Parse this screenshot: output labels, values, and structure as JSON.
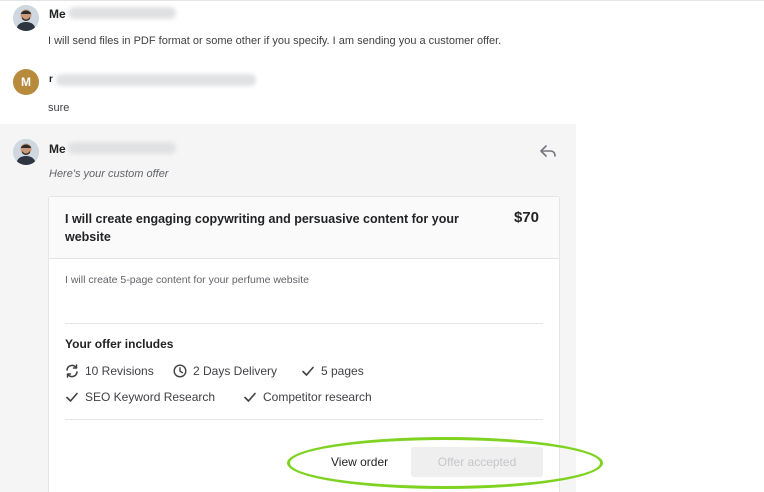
{
  "messages": [
    {
      "sender": "Me",
      "text": "I will send files in PDF format or some other if you specify. I am sending you a customer offer."
    },
    {
      "avatar_letter": "M",
      "sender": "r",
      "text": "sure"
    },
    {
      "sender": "Me",
      "subtitle": "Here's your custom offer",
      "reply_icon": "reply-icon"
    }
  ],
  "offer": {
    "title": "I will create engaging copywriting and persuasive content for your website",
    "price": "$70",
    "description": "I will create 5-page content for your perfume website",
    "includes_title": "Your offer includes",
    "features": [
      {
        "icon": "refresh-icon",
        "label": "10 Revisions"
      },
      {
        "icon": "clock-icon",
        "label": "2 Days Delivery"
      },
      {
        "icon": "check-icon",
        "label": "5 pages"
      },
      {
        "icon": "check-icon",
        "label": "SEO Keyword Research"
      },
      {
        "icon": "check-icon",
        "label": "Competitor research"
      }
    ],
    "view_order_label": "View order",
    "accepted_label": "Offer accepted"
  },
  "colors": {
    "highlight": "#7ed321",
    "avatar_letter_bg": "#b88a3c",
    "panel_bg": "#f5f5f5"
  }
}
